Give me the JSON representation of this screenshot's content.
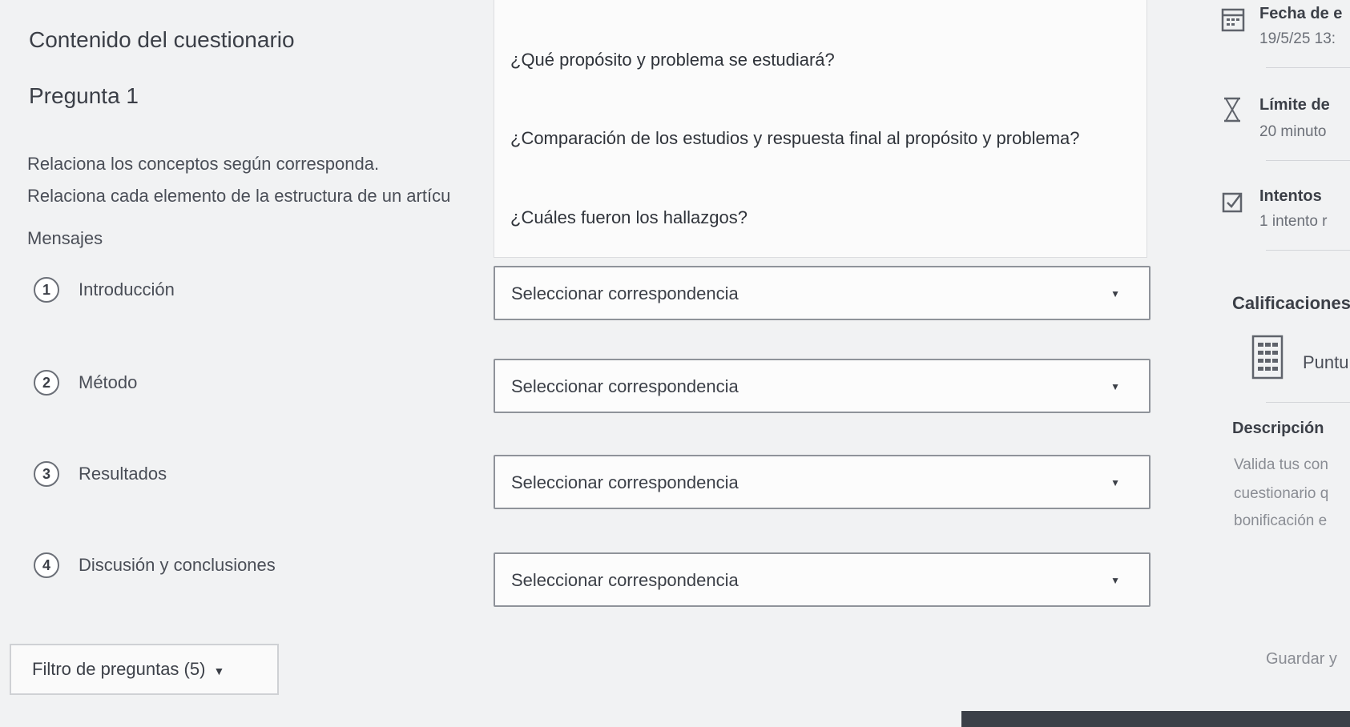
{
  "header": {
    "title": "Contenido del cuestionario"
  },
  "question": {
    "heading": "Pregunta 1",
    "instruction": "Relaciona los conceptos según corresponda.",
    "instruction_detail": "Relaciona cada elemento de la estructura de un artícu",
    "messages_label": "Mensajes"
  },
  "terms": [
    {
      "number": "1",
      "label": "Introducción"
    },
    {
      "number": "2",
      "label": "Método"
    },
    {
      "number": "3",
      "label": "Resultados"
    },
    {
      "number": "4",
      "label": "Discusión y conclusiones"
    }
  ],
  "answers": [
    "¿Qué propósito y problema se estudiará?",
    "¿Comparación de los estudios y respuesta final al propósito y problema?",
    "¿Cuáles fueron los hallazgos?"
  ],
  "selects": [
    {
      "value": "Seleccionar correspondencia"
    },
    {
      "value": "Seleccionar correspondencia"
    },
    {
      "value": "Seleccionar correspondencia"
    },
    {
      "value": "Seleccionar correspondencia"
    }
  ],
  "sidebar": {
    "due": {
      "title": "Fecha de e",
      "value": "19/5/25 13:"
    },
    "time_limit": {
      "title": "Límite de",
      "value": "20 minuto"
    },
    "attempts": {
      "title": "Intentos",
      "value": "1 intento r"
    },
    "grades_heading": "Calificaciones",
    "points_label": "Puntu",
    "description_heading": "Descripción",
    "description_lines": [
      "Valida tus con",
      "cuestionario q",
      "bonificación e"
    ],
    "save_label": "Guardar y"
  },
  "footer": {
    "filter_label": "Filtro de preguntas (5)"
  },
  "icons": {
    "calendar": "calendar-icon",
    "hourglass": "hourglass-icon",
    "attempts": "checkbox-icon",
    "points": "calculator-icon",
    "dropdown": "caret-down-icon"
  },
  "colors": {
    "background": "#f1f2f3",
    "panel": "#fbfbfb",
    "text": "#4a4e57",
    "border": "#8f939a"
  }
}
